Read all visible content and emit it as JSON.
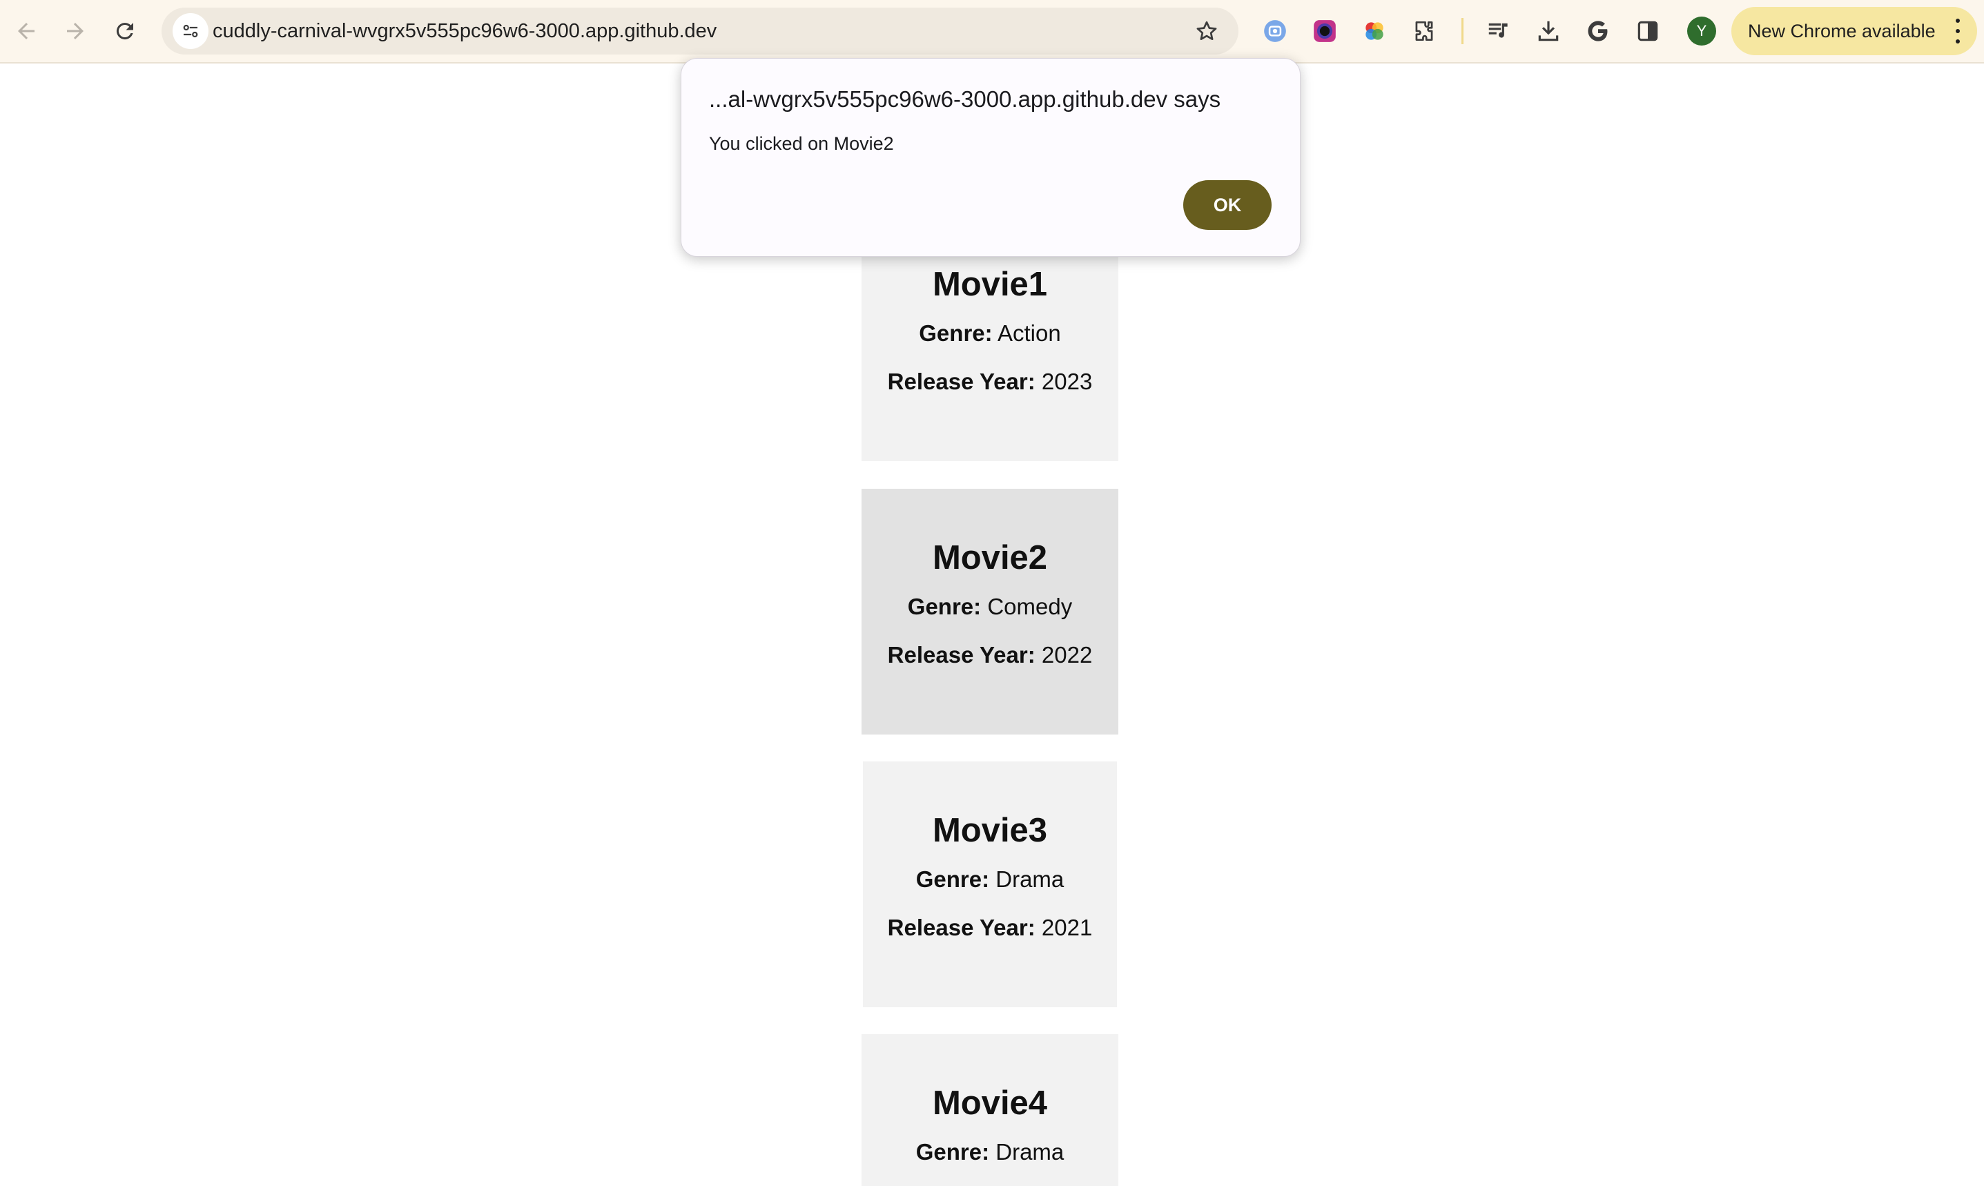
{
  "browser": {
    "url": "cuddly-carnival-wvgrx5v555pc96w6-3000.app.github.dev",
    "update_label": "New Chrome available",
    "avatar_initial": "Y",
    "icons": [
      "back-arrow-icon",
      "forward-arrow-icon",
      "reload-icon",
      "site-info-icon",
      "bookmark-star-icon",
      "extension-icons",
      "puzzle-icon",
      "media-icon",
      "download-icon",
      "google-icon",
      "side-panel-icon",
      "kebab-menu-icon"
    ]
  },
  "dialog": {
    "title": "...al-wvgrx5v555pc96w6-3000.app.github.dev says",
    "message": "You clicked on Movie2",
    "ok_label": "OK"
  },
  "labels": {
    "genre": "Genre:",
    "year": "Release Year:"
  },
  "movies": [
    {
      "title": "Movie1",
      "genre": "Action",
      "year": "2023"
    },
    {
      "title": "Movie2",
      "genre": "Comedy",
      "year": "2022"
    },
    {
      "title": "Movie3",
      "genre": "Drama",
      "year": "2021"
    },
    {
      "title": "Movie4",
      "genre": "Drama"
    }
  ],
  "colors": {
    "toolbar": "#fcf6ec",
    "card": "#f2f2f2",
    "card_hover": "#e2e2e2",
    "ok_button": "#675d1e",
    "update_chip": "#f6e7a1"
  }
}
